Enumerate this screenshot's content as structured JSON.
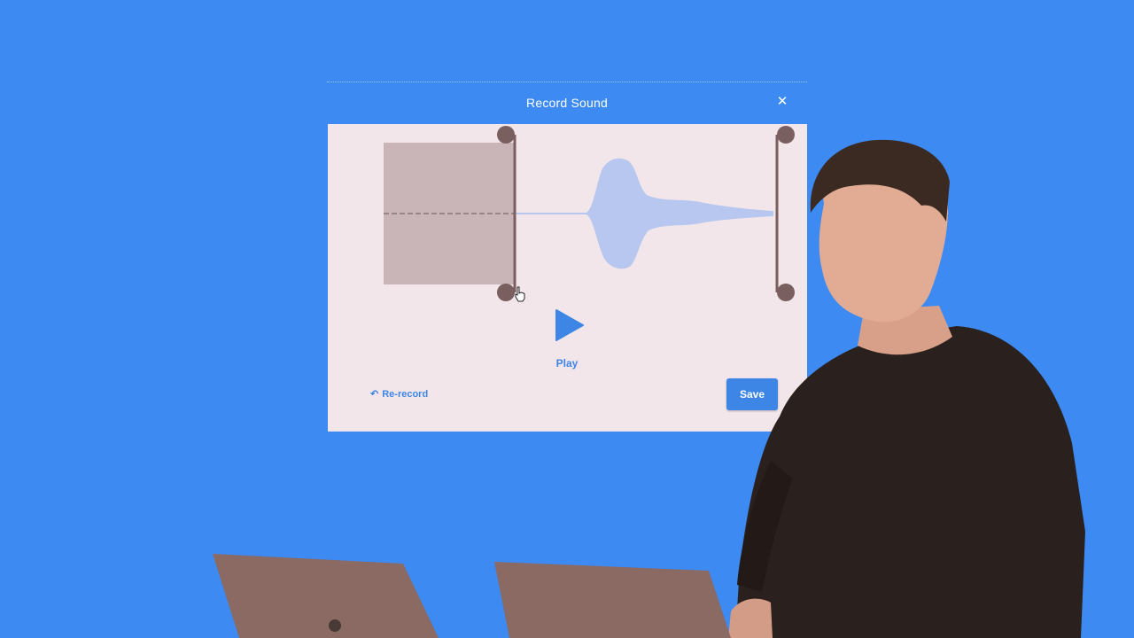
{
  "modal": {
    "title": "Record Sound",
    "close_icon": "close-icon",
    "play_label": "Play",
    "rerecord_label": "Re-record",
    "rerecord_icon": "undo-arrow-icon",
    "save_label": "Save"
  },
  "trim": {
    "left_handle_fraction": 0.32,
    "right_handle_fraction": 1.0
  },
  "colors": {
    "background": "#3d8af2",
    "modal_body": "#f3e6ea",
    "accent": "#3d86e6",
    "waveform": "#b8c7ef",
    "trimmed_region": "#c8b3b6",
    "handle": "#7a5f60"
  }
}
